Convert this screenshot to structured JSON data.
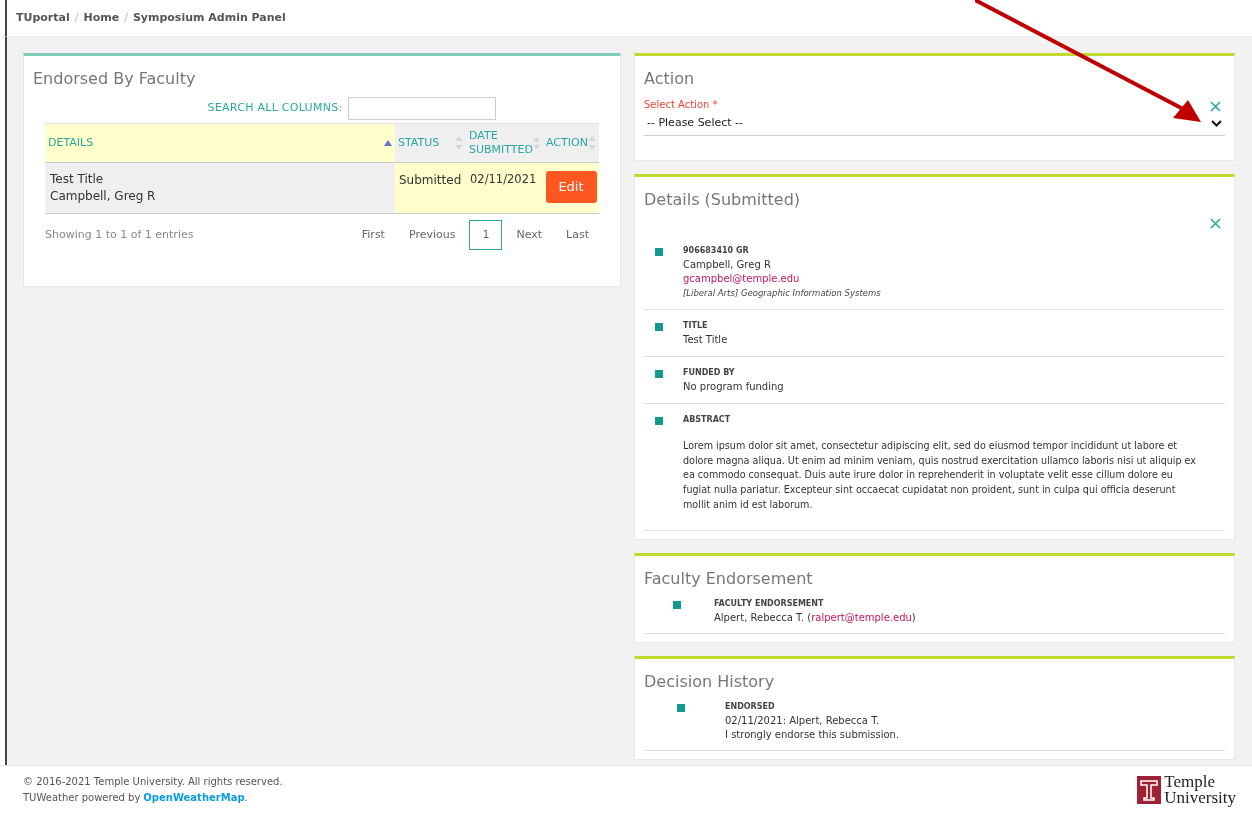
{
  "breadcrumb": [
    {
      "label": "TUportal",
      "separator": "/"
    },
    {
      "label": "Home",
      "separator": "/"
    },
    {
      "label": "Symposium Admin Panel"
    }
  ],
  "endorsed": {
    "title": "Endorsed By Faculty",
    "search_label": "SEARCH ALL COLUMNS:",
    "columns": [
      {
        "label": "DETAILS",
        "sorted": true
      },
      {
        "label": "STATUS",
        "sorted": false
      },
      {
        "label": "DATE SUBMITTED",
        "sorted": false
      },
      {
        "label": "ACTION",
        "sorted": false
      }
    ],
    "rows": [
      {
        "details": [
          "Test Title",
          "Campbell, Greg R"
        ],
        "status": "Submitted",
        "date": "02/11/2021",
        "action": "Edit"
      }
    ],
    "info": "Showing 1 to 1 of 1 entries",
    "pages": [
      {
        "label": "First",
        "kind": "nav"
      },
      {
        "label": "Previous",
        "kind": "nav"
      },
      {
        "label": "1",
        "kind": "page",
        "selected": true
      },
      {
        "label": "Next",
        "kind": "nav"
      },
      {
        "label": "Last",
        "kind": "nav"
      }
    ]
  },
  "action": {
    "title": "Action",
    "field_label": "Select Action *",
    "value": "-- Please Select --"
  },
  "details": {
    "title": "Details (Submitted)",
    "items": [
      {
        "label": "906683410 GR",
        "lines": [
          {
            "kind": "text",
            "text": "Campbell, Greg R"
          },
          {
            "kind": "link",
            "text": "gcampbel@temple.edu"
          },
          {
            "kind": "italic",
            "text": "[Liberal Arts] Geographic Information Systems"
          }
        ]
      },
      {
        "label": "TITLE",
        "lines": [
          {
            "kind": "text",
            "text": "Test Title"
          }
        ]
      },
      {
        "label": "FUNDED BY",
        "lines": [
          {
            "kind": "text",
            "text": "No program funding"
          }
        ]
      },
      {
        "label": "ABSTRACT",
        "lines": [
          {
            "kind": "paragraph",
            "text": "Lorem ipsum dolor sit amet, consectetur adipiscing elit, sed do eiusmod tempor incididunt ut labore et dolore magna aliqua. Ut enim ad minim veniam, quis nostrud exercitation ullamco laboris nisi ut aliquip ex ea commodo consequat. Duis aute irure dolor in reprehenderit in voluptate velit esse cillum dolore eu fugiat nulla pariatur. Excepteur sint occaecat cupidatat non proident, sunt in culpa qui officia deserunt mollit anim id est laborum."
          }
        ]
      }
    ]
  },
  "faculty": {
    "title": "Faculty Endorsement",
    "items": [
      {
        "label": "FACULTY ENDORSEMENT",
        "name": "Alpert, Rebecca T. (",
        "email": "ralpert@temple.edu",
        "close": ")"
      }
    ]
  },
  "history": {
    "title": "Decision History",
    "items": [
      {
        "label": "ENDORSED",
        "lines": [
          "02/11/2021: Alpert, Rebecca T.",
          "I strongly endorse this submission."
        ]
      }
    ]
  },
  "footer": {
    "copyright": "© 2016-2021 Temple University. All rights reserved.",
    "weather": "TUWeather powered by",
    "weather_link": "OpenWeatherMap",
    "weather_end": ".",
    "logo": [
      "Temple",
      "University"
    ]
  }
}
